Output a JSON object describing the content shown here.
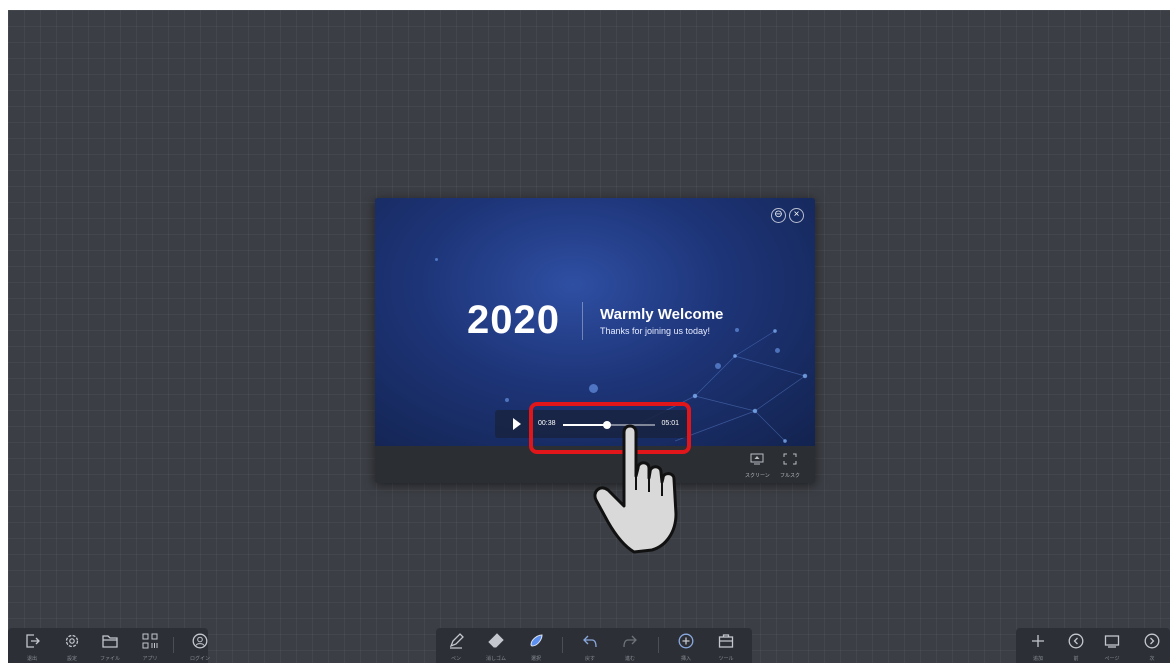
{
  "video": {
    "year": "2020",
    "title": "Warmly Welcome",
    "subtitle": "Thanks for joining us today!",
    "current_time": "00:38",
    "total_time": "05:01",
    "progress": 0.48,
    "minimize_glyph": "⊖",
    "close_glyph": "×",
    "accent_color": "#1d3477"
  },
  "player_buttons": {
    "screenshot_label": "スクリーン",
    "fullscreen_label": "フルスク"
  },
  "highlight_color": "#e0161b",
  "left_toolbar": {
    "exit_label": "退出",
    "settings_label": "設定",
    "file_label": "ファイル",
    "apps_label": "アプリ",
    "login_label": "ログイン"
  },
  "center_toolbar": {
    "pen_label": "ペン",
    "eraser_label": "消しゴム",
    "select_label": "選択",
    "undo_label": "戻す",
    "redo_label": "進む",
    "insert_label": "挿入",
    "tools_label": "ツール"
  },
  "right_toolbar": {
    "add_label": "追加",
    "prev_label": "前",
    "pages_label": "ページ",
    "next_label": "次"
  }
}
